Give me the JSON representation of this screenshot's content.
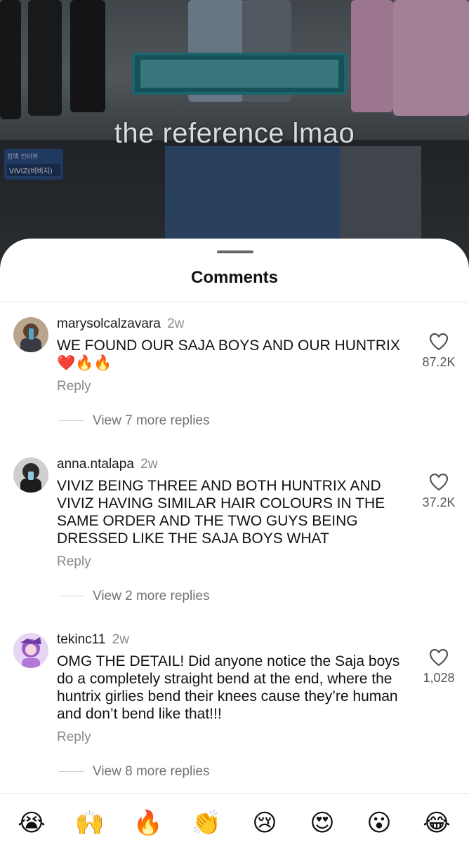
{
  "video": {
    "caption": "the reference lmao",
    "tag_line1": "컴백 인터뷰",
    "tag_line2": "VIVIZ(비비지)"
  },
  "sheet": {
    "title": "Comments"
  },
  "comments": [
    {
      "username": "marysolcalzavara",
      "time": "2w",
      "text": "WE FOUND OUR SAJA BOYS AND OUR HUNTRIX\n❤️🔥🔥",
      "likes": "87.2K",
      "reply": "Reply",
      "more_replies": "View 7 more replies"
    },
    {
      "username": "anna.ntalapa",
      "time": "2w",
      "text": "VIVIZ BEING THREE AND BOTH HUNTRIX AND VIVIZ HAVING SIMILAR HAIR COLOURS IN THE SAME ORDER AND THE TWO GUYS BEING DRESSED LIKE THE SAJA BOYS WHAT",
      "likes": "37.2K",
      "reply": "Reply",
      "more_replies": "View 2 more replies"
    },
    {
      "username": "tekinc11",
      "time": "2w",
      "text": "OMG THE DETAIL! Did anyone notice the Saja boys do a completely straight bend at the end, where the huntrix girlies bend their knees cause they’re human and don’t bend like that!!!",
      "likes": "1,028",
      "reply": "Reply",
      "more_replies": "View 8 more replies"
    }
  ],
  "emoji_bar": [
    "😭",
    "🙌",
    "🔥",
    "👏",
    "😢",
    "😍",
    "😮",
    "😂"
  ]
}
